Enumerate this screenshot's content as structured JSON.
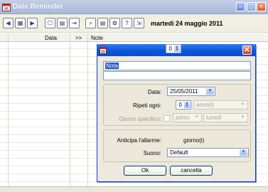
{
  "window": {
    "title": "Date Reminder",
    "icon": "calendar-icon",
    "controls": {
      "minimize": "minimize-icon",
      "maximize": "maximize-icon",
      "close": "close-icon"
    }
  },
  "toolbar": {
    "buttons": [
      {
        "name": "prev-button",
        "icon": "arrow-left-icon",
        "glyph": "◀"
      },
      {
        "name": "calendar-button",
        "icon": "calendar-grid-icon",
        "glyph": "▦"
      },
      {
        "name": "next-button",
        "icon": "arrow-right-icon",
        "glyph": "▶"
      },
      {
        "name": "new-button",
        "icon": "new-document-icon",
        "glyph": "☐"
      },
      {
        "name": "edit-button",
        "icon": "document-icon",
        "glyph": "▤"
      },
      {
        "name": "export-button",
        "icon": "export-icon",
        "glyph": "⇥"
      },
      {
        "name": "search-button",
        "icon": "magnifier-icon",
        "glyph": "⌕"
      },
      {
        "name": "list-button",
        "icon": "list-icon",
        "glyph": "▤"
      },
      {
        "name": "settings-button",
        "icon": "gear-icon",
        "glyph": "✿"
      },
      {
        "name": "help-button",
        "icon": "help-icon",
        "glyph": "?"
      },
      {
        "name": "exit-button",
        "icon": "exit-icon",
        "glyph": "⇲"
      }
    ],
    "current_date": "martedì 24 maggio 2011"
  },
  "grid": {
    "headers": {
      "data": "Data",
      "sep": ">>",
      "note": "Note"
    }
  },
  "dialog": {
    "icon": "calendar-icon",
    "close_glyph": "✕",
    "note_value": "Nota",
    "labels": {
      "data": "Data:",
      "repeat": "Ripeti ogni:",
      "specific_day": "Giorno specifico:",
      "alarm_advance": "Anticipa l'allarme:",
      "sound": "Suono:"
    },
    "values": {
      "date": "25/05/2011",
      "repeat_count": "0",
      "repeat_unit": "anno(i)",
      "specific_ordinal": "primo",
      "specific_weekday": "lunedì",
      "alarm_count": "0",
      "alarm_unit": "giorno(i)",
      "sound": "Default"
    },
    "buttons": {
      "ok": "Ok",
      "cancel": "cancella"
    }
  }
}
